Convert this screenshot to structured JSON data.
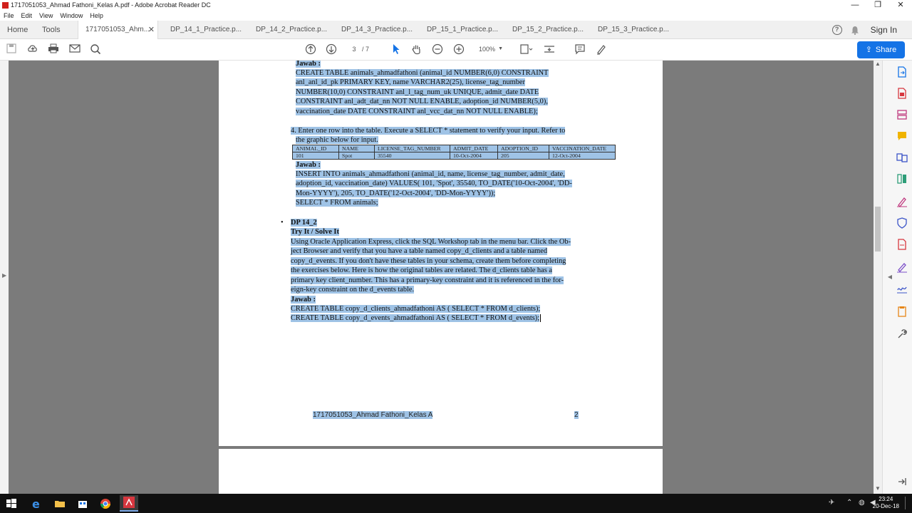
{
  "window": {
    "title": "1717051053_Ahmad Fathoni_Kelas A.pdf - Adobe Acrobat Reader DC",
    "controls": [
      "—",
      "❐",
      "✕"
    ]
  },
  "menu": [
    "File",
    "Edit",
    "View",
    "Window",
    "Help"
  ],
  "tabs": {
    "home": "Home",
    "tools": "Tools",
    "docs": [
      "1717051053_Ahm...",
      "DP_14_1_Practice.p...",
      "DP_14_2_Practice.p...",
      "DP_14_3_Practice.p...",
      "DP_15_1_Practice.p...",
      "DP_15_2_Practice.p...",
      "DP_15_3_Practice.p..."
    ],
    "close": "✕",
    "sign_in": "Sign In",
    "help": "?"
  },
  "toolbar": {
    "page_current": "3",
    "page_total": "/ 7",
    "zoom": "100%",
    "share": "Share"
  },
  "document": {
    "jawab": "Jawab :",
    "create_table_lines": [
      "CREATE TABLE  animals_ahmadfathoni (animal_id  NUMBER(6,0) CONSTRAINT",
      "anl_anl_id_pk PRIMARY KEY, name VARCHAR2(25), license_tag_number",
      "NUMBER(10,0)  CONSTRAINT anl_l_tag_num_uk UNIQUE, admit_date  DATE",
      "CONSTRAINT anl_adt_dat_nn NOT NULL ENABLE, adoption_id   NUMBER(5,0),",
      "vaccination_date  DATE CONSTRAINT anl_vcc_dat_nn NOT NULL ENABLE);"
    ],
    "step4_lines": [
      "4. Enter one row into the table. Execute a SELECT * statement to verify your input. Refer to",
      "the graphic below for input."
    ],
    "table": {
      "headers": [
        "ANIMAL_ID",
        "NAME",
        "LICENSE_TAG_NUMBER",
        "ADMIT_DATE",
        "ADOPTION_ID",
        "VACCINATION_DATE"
      ],
      "row": [
        "101",
        "Spot",
        "35540",
        "10-Oct-2004",
        "205",
        "12-Oct-2004"
      ]
    },
    "insert_lines": [
      "INSERT INTO animals_ahmadfathoni (animal_id, name, license_tag_number, admit_date,",
      "adoption_id, vaccination_date) VALUES( 101, 'Spot', 35540, TO_DATE('10-Oct-2004', 'DD-",
      "Mon-YYYY'), 205, TO_DATE('12-Oct-2004', 'DD-Mon-YYYY'));",
      "SELECT * FROM animals;"
    ],
    "bullet": "•",
    "section_title": "DP 14_2",
    "try_it": "Try It / Solve It",
    "para_lines": [
      "Using Oracle Application Express, click the SQL Workshop tab in the menu bar. Click the Ob-",
      "ject Browser and verify that you have a table named copy_d_clients and a table named",
      "copy_d_events. If you don't have these tables in your schema, create them before completing",
      "the exercises below. Here is how the original tables are related. The d_clients table has a",
      "primary key client_number. This has a primary-key constraint and it is referenced in the for-",
      "eign-key constraint on the d_events table."
    ],
    "jawab2": "Jawab :",
    "answer_lines": [
      "CREATE TABLE copy_d_clients_ahmadfathoni AS ( SELECT * FROM d_clients);",
      "CREATE TABLE copy_d_events_ahmadfathoni AS ( SELECT * FROM d_events);"
    ],
    "footer_left": "1717051053_Ahmad Fathoni_Kelas A",
    "footer_right": "2"
  },
  "taskbar": {
    "time": "23:24",
    "date": "20-Dec-18"
  },
  "colors": {
    "selection": "#9fc3e6",
    "share_button": "#1473e6",
    "doc_background": "#7b7b7b"
  }
}
